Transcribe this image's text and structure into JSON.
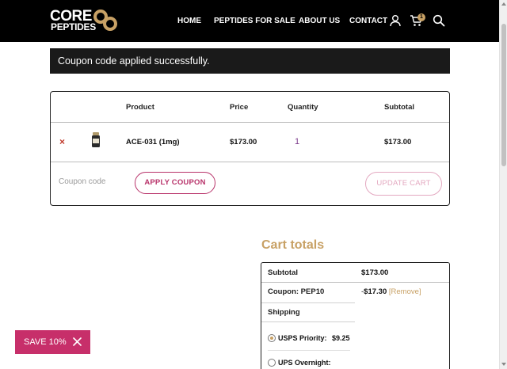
{
  "brand": {
    "logo_line1": "CORE",
    "logo_line2": "PEPTIDES",
    "accent_color": "#c8a165",
    "pink_color": "#c72f6a"
  },
  "nav": {
    "home": "HOME",
    "peptides": "PEPTIDES FOR SALE",
    "about": "ABOUT US",
    "contact": "CONTACT"
  },
  "header_icons": [
    "user-icon",
    "cart-icon",
    "search-icon"
  ],
  "cart_badge": "1",
  "notice": "Coupon code applied successfully.",
  "cart": {
    "headers": {
      "product": "Product",
      "price": "Price",
      "quantity": "Quantity",
      "subtotal": "Subtotal"
    },
    "rows": [
      {
        "remove": "×",
        "name": "ACE-031 (1mg)",
        "price": "$173.00",
        "quantity": "1",
        "subtotal": "$173.00"
      }
    ],
    "coupon_placeholder": "Coupon code",
    "apply_label": "APPLY COUPON",
    "update_label": "UPDATE CART"
  },
  "totals": {
    "title": "Cart totals",
    "subtotal_label": "Subtotal",
    "subtotal_value": "$173.00",
    "coupon_label": "Coupon: PEP10",
    "coupon_value_prefix": "-",
    "coupon_value": "$17.30",
    "coupon_remove": "[Remove]",
    "shipping_label": "Shipping",
    "shipping_options": [
      {
        "label": "USPS Priority:",
        "price": "$9.25",
        "selected": true
      },
      {
        "label": "UPS Overnight:",
        "price": "",
        "selected": false
      }
    ]
  },
  "save_badge": "SAVE 10%"
}
